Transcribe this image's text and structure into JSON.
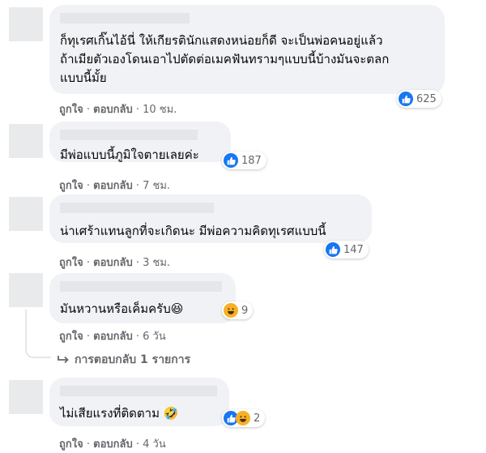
{
  "comments": [
    {
      "lines": [
        "ก็ทุเรศเกิ๊นไอ้นี่ ให้เกียรตินักแสดงหน่อยก็ดี จะเป็นพ่อคนอยู่แล้ว",
        "ถ้าเมียตัวเองโดนเอาไปตัดต่อเมคฟันทรามๆแบบนี้บ้างมันจะตลก",
        "แบบนี้มั้ย"
      ],
      "reaction_count": "625",
      "reactions": [
        "like-icon"
      ],
      "like_label": "ถูกใจ",
      "reply_label": "ตอบกลับ",
      "time": "10 ชม."
    },
    {
      "lines": [
        "มีพ่อแบบนี้ภูมิใจตายเลยค่ะ"
      ],
      "reaction_count": "187",
      "reactions": [
        "like-icon"
      ],
      "like_label": "ถูกใจ",
      "reply_label": "ตอบกลับ",
      "time": "7 ชม."
    },
    {
      "lines": [
        "น่าเศร้าแทนลูกที่จะเกิดนะ มีพ่อความคิดทุเรศแบบนี้"
      ],
      "reaction_count": "147",
      "reactions": [
        "like-icon"
      ],
      "like_label": "ถูกใจ",
      "reply_label": "ตอบกลับ",
      "time": "3 ชม."
    },
    {
      "lines": [
        "มันหวานหรือเค็มครับ😆"
      ],
      "reaction_count": "9",
      "reactions": [
        "haha-icon"
      ],
      "like_label": "ถูกใจ",
      "reply_label": "ตอบกลับ",
      "time": "6 วัน",
      "replies_label": "การตอบกลับ 1 รายการ"
    },
    {
      "lines": [
        "ไม่เสียแรงที่ติดตาม 🤣"
      ],
      "reaction_count": "2",
      "reactions": [
        "like-icon",
        "haha-icon"
      ],
      "like_label": "ถูกใจ",
      "reply_label": "ตอบกลับ",
      "time": "4 วัน"
    }
  ],
  "colors": {
    "bubble": "#f0f2f5",
    "like": "#1877f2",
    "haha": "#f7b125",
    "meta": "#65676b"
  }
}
